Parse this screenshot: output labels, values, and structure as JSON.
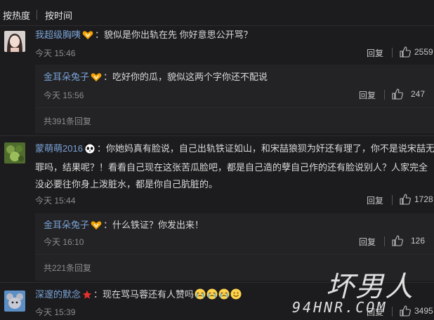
{
  "sort": {
    "hot": "按热度",
    "time": "按时间"
  },
  "comments": [
    {
      "user": "我超级胸咦",
      "text": "：貌似是你出轨在先  你好意思公开骂？",
      "time": "今天 15:46",
      "reply": "回复",
      "likes": "2559",
      "replies": [
        {
          "user": "金耳朵兔子",
          "text": "：吃好你的瓜，貌似这两个字你还不配说",
          "time": "今天 15:56",
          "reply": "回复",
          "likes": "247"
        }
      ],
      "more": "共391条回复"
    },
    {
      "user": "蒙萌萌2016",
      "text": "：你她妈真有脸说，自己出轨铁证如山，和宋喆狼狈为奸还有理了，你不是说宋喆无罪吗，结果呢？！看看自己现在这张苦瓜脸吧，都是自己造的孽自己作的还有脸说别人？人家完全没必要往你身上泼脏水，都是你自己肮脏的。",
      "time": "今天 15:44",
      "reply": "回复",
      "likes": "1728",
      "replies": [
        {
          "user": "金耳朵兔子",
          "text": "：什么铁证？你发出来！",
          "time": "今天 16:10",
          "reply": "回复",
          "likes": "126"
        }
      ],
      "more": "共221条回复"
    },
    {
      "user": "深邃的默念",
      "text": "：现在骂马蓉还有人赞吗",
      "time": "今天 15:39",
      "reply": "回复",
      "likes": "3495"
    }
  ],
  "watermark": {
    "chars": "坏男人",
    "url": "94HNR.COM"
  },
  "icons": [
    "thumbs-up-icon",
    "vip-badge-icon",
    "panda-icon",
    "star-icon",
    "crying-emoji-icon",
    "smile-emoji-icon"
  ]
}
